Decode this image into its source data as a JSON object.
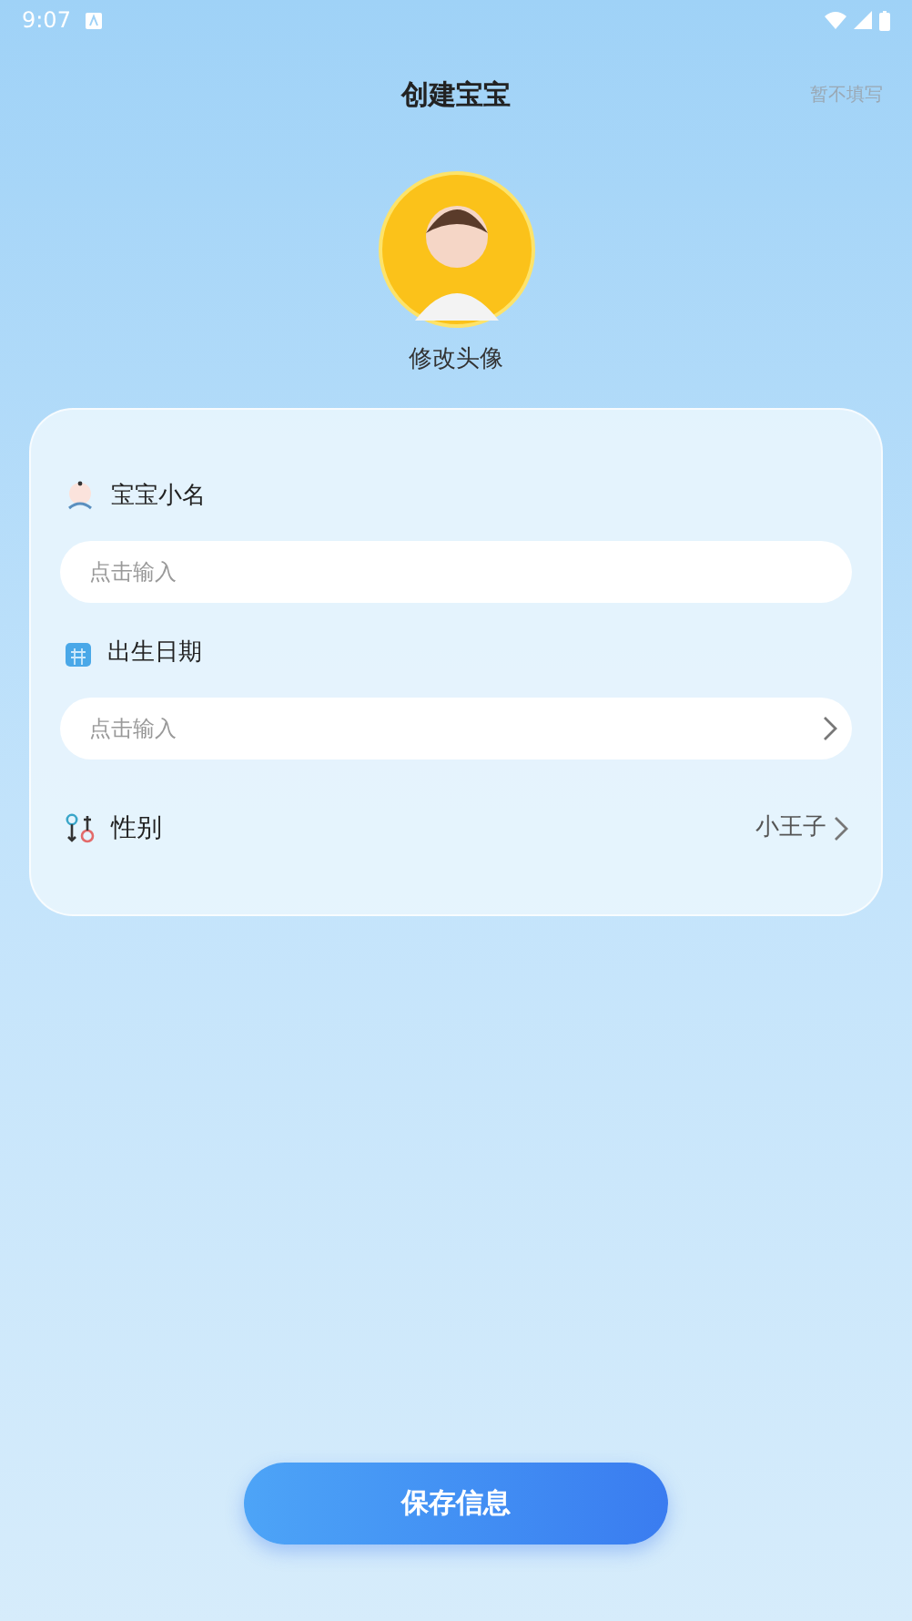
{
  "status_bar": {
    "time": "9:07"
  },
  "header": {
    "title": "创建宝宝",
    "skip": "暂不填写"
  },
  "avatar": {
    "caption": "修改头像"
  },
  "form": {
    "fields": [
      {
        "kind": "text",
        "label": "宝宝小名",
        "placeholder": "点击输入"
      },
      {
        "kind": "picker",
        "label": "出生日期",
        "placeholder": "点击输入"
      },
      {
        "kind": "select",
        "label": "性别",
        "value": "小王子"
      }
    ]
  },
  "save_button": "保存信息"
}
